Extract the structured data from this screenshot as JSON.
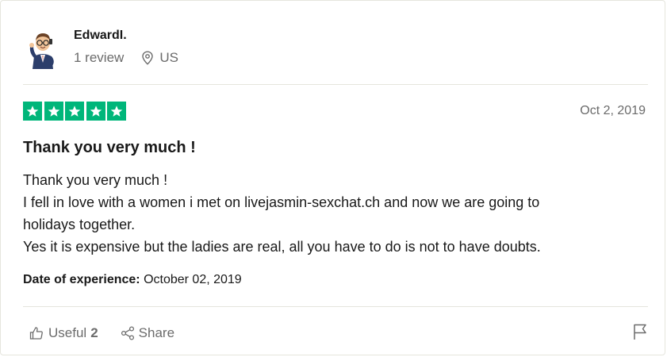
{
  "reviewer": {
    "name": "EdwardI.",
    "review_count": "1 review",
    "country": "US",
    "avatar_icon": "businessman-avatar-icon"
  },
  "review": {
    "rating": 5,
    "star_color": "#00b67a",
    "date": "Oct 2, 2019",
    "title": "Thank you very much !",
    "body_lines": [
      "Thank you very much !",
      "I fell in love with a women i met on livejasmin-sexchat.ch and now we are going to",
      "holidays together.",
      "Yes it is expensive but the ladies are real, all you have to do is not to have doubts."
    ],
    "experience_label": "Date of experience:",
    "experience_date": "October 02, 2019"
  },
  "actions": {
    "useful_label": "Useful",
    "useful_count": "2",
    "share_label": "Share",
    "useful_icon": "thumbs-up-icon",
    "share_icon": "share-icon",
    "flag_icon": "flag-icon"
  }
}
